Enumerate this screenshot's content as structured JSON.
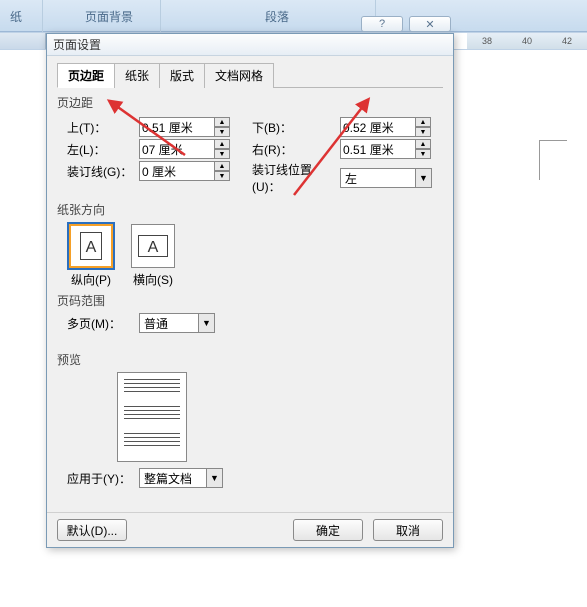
{
  "ribbon": {
    "left": "纸",
    "bg": "页面背景",
    "para": "段落"
  },
  "ruler": {
    "marks": [
      "38",
      "40",
      "42"
    ]
  },
  "dialog": {
    "title": "页面设置",
    "help": "?",
    "close": "✕",
    "tabs": [
      "页边距",
      "纸张",
      "版式",
      "文档网格"
    ],
    "group_margins": "页边距",
    "fields": {
      "top_lbl": "上(T)：",
      "top_val": "0.51 厘米",
      "bottom_lbl": "下(B)：",
      "bottom_val": "0.52 厘米",
      "left_lbl": "左(L)：",
      "left_val": "07 厘米",
      "right_lbl": "右(R)：",
      "right_val": "0.51 厘米",
      "gutter_lbl": "装订线(G)：",
      "gutter_val": "0 厘米",
      "gutterpos_lbl": "装订线位置(U)：",
      "gutterpos_val": "左"
    },
    "group_orient": "纸张方向",
    "orient": {
      "portrait": "纵向(P)",
      "landscape": "横向(S)"
    },
    "group_pages": "页码范围",
    "multi_lbl": "多页(M)：",
    "multi_val": "普通",
    "group_preview": "预览",
    "apply_lbl": "应用于(Y)：",
    "apply_val": "整篇文档",
    "btn_default": "默认(D)...",
    "btn_ok": "确定",
    "btn_cancel": "取消"
  }
}
